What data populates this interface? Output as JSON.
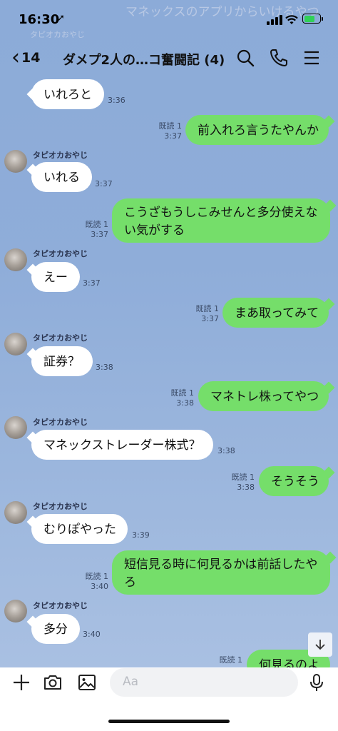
{
  "status": {
    "time": "16:30",
    "location_glyph": "➚",
    "ghost_banner": "マネックスのアプリからいけるやつ",
    "ghost_banner2": "タピオカおやじ"
  },
  "header": {
    "back_glyph": "‹",
    "unread_count": "14",
    "title": "ダメプ2人の…コ奮闘記 (4)"
  },
  "sender_name": "タピオカおやじ",
  "messages": [
    {
      "id": "m1",
      "dir": "in",
      "text": "いれろと",
      "time": "3:36"
    },
    {
      "id": "m2",
      "dir": "out",
      "text": "前入れろ言うたやんか",
      "read": "既読 1",
      "time": "3:37"
    },
    {
      "id": "m3",
      "dir": "in",
      "text": "いれる",
      "time": "3:37"
    },
    {
      "id": "m4",
      "dir": "out",
      "text": "こうざもうしこみせんと多分使えない気がする",
      "read": "既読 1",
      "time": "3:37"
    },
    {
      "id": "m5",
      "dir": "in",
      "text": "えー",
      "time": "3:37"
    },
    {
      "id": "m6",
      "dir": "out",
      "text": "まあ取ってみて",
      "read": "既読 1",
      "time": "3:37"
    },
    {
      "id": "m7",
      "dir": "in",
      "text": "証券？",
      "time": "3:38"
    },
    {
      "id": "m8",
      "dir": "out",
      "text": "マネトレ株ってやつ",
      "read": "既読 1",
      "time": "3:38"
    },
    {
      "id": "m9",
      "dir": "in",
      "text": "マネックストレーダー株式？",
      "time": "3:38"
    },
    {
      "id": "m10",
      "dir": "out",
      "text": "そうそう",
      "read": "既読 1",
      "time": "3:38"
    },
    {
      "id": "m11",
      "dir": "in",
      "text": "むりぽやった",
      "time": "3:39"
    },
    {
      "id": "m12",
      "dir": "out",
      "text": "短信見る時に何見るかは前話したやろ",
      "read": "既読 1",
      "time": "3:40"
    },
    {
      "id": "m13",
      "dir": "in",
      "text": "多分",
      "time": "3:40"
    },
    {
      "id": "m14",
      "dir": "out",
      "text": "何見るのよ",
      "read": "既読 1",
      "time": ""
    }
  ],
  "input": {
    "placeholder": "Aa"
  },
  "icons": {
    "search": "search-icon",
    "call": "phone-icon",
    "menu": "menu-icon",
    "add": "plus-icon",
    "camera": "camera-icon",
    "image": "image-icon",
    "emoji": "emoji-icon",
    "mic": "mic-icon",
    "scroll": "arrow-down-icon"
  },
  "colors": {
    "background": "#8cabd8",
    "outgoing_bubble": "#75de6a",
    "incoming_bubble": "#ffffff",
    "battery": "#30d158"
  }
}
